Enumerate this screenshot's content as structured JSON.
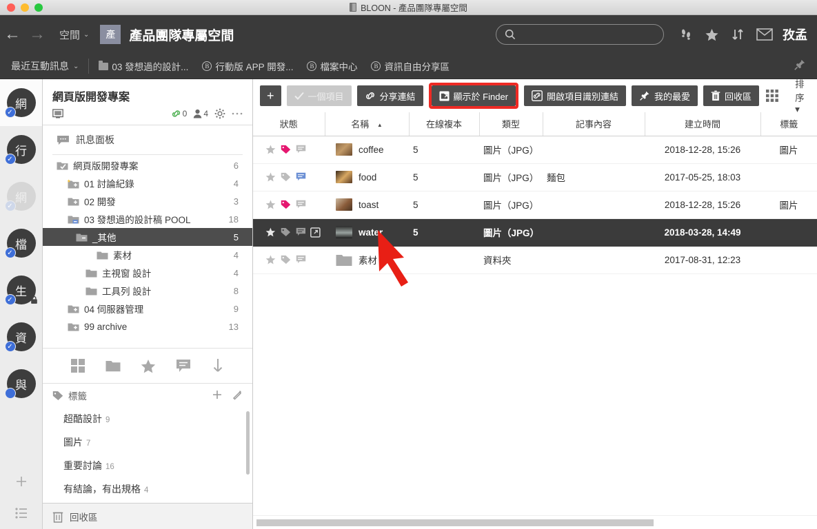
{
  "window": {
    "title": "BLOON - 產品團隊專屬空間",
    "title_icon": "book-icon"
  },
  "navbar": {
    "back_icon": "arrow-left-icon",
    "forward_icon": "arrow-right-icon",
    "space_label": "空間",
    "space_caret": "⌄",
    "space_badge": "產",
    "space_title": "產品團隊專屬空間",
    "search_placeholder": "",
    "search_value": "",
    "icons": [
      "footprints-icon",
      "star-icon",
      "sort-icon",
      "mail-icon"
    ],
    "user_name": "孜孟"
  },
  "tabbar": {
    "recent_label": "最近互動訊息",
    "recent_caret": "⌄",
    "tabs": [
      {
        "label": "03 發想過的設計...",
        "icon": "folder-icon"
      },
      {
        "label": "行動版 APP 開發...",
        "icon": "b-circle-icon"
      },
      {
        "label": "檔案中心",
        "icon": "b-circle-icon"
      },
      {
        "label": "資訊自由分享區",
        "icon": "b-circle-icon"
      }
    ],
    "pin_icon": "pin-icon"
  },
  "rail": {
    "items": [
      {
        "label": "網",
        "state": "active",
        "badge": "check",
        "locked": false
      },
      {
        "label": "行",
        "state": "normal",
        "badge": "check",
        "locked": false
      },
      {
        "label": "網",
        "state": "dim",
        "badge": "check-dim",
        "locked": false
      },
      {
        "label": "檔",
        "state": "normal",
        "badge": "check",
        "locked": false
      },
      {
        "label": "生",
        "state": "normal",
        "badge": "check",
        "locked": true
      },
      {
        "label": "資",
        "state": "normal",
        "badge": "check",
        "locked": false
      },
      {
        "label": "與",
        "state": "normal",
        "badge": "dot",
        "locked": false
      }
    ],
    "add_icon": "plus-icon",
    "list_icon": "list-icon"
  },
  "sidebar": {
    "project_title": "網頁版開發專案",
    "project_icon": "screen-icon",
    "link_count": "0",
    "member_count": "4",
    "gear_icon": "gear-icon",
    "more_icon": "more-icon",
    "message_panel": "訊息面板",
    "message_panel_icon": "chat-icon",
    "tree": [
      {
        "label": "網頁版開發專案",
        "count": "6",
        "indent": 0,
        "icon": "folder-check",
        "selected": false,
        "star": false
      },
      {
        "label": "01 討論紀錄",
        "count": "4",
        "indent": 1,
        "icon": "folder-plus",
        "selected": false,
        "star": true
      },
      {
        "label": "02 開發",
        "count": "3",
        "indent": 1,
        "icon": "folder-plus",
        "selected": false,
        "star": false
      },
      {
        "label": "03 發想過的設計稿 POOL",
        "count": "18",
        "indent": 1,
        "icon": "folder-open",
        "selected": false,
        "star": false
      },
      {
        "label": "_其他",
        "count": "5",
        "indent": 2,
        "icon": "folder-minus",
        "selected": true,
        "star": false
      },
      {
        "label": "素材",
        "count": "4",
        "indent": 3,
        "icon": "folder-plain",
        "selected": false,
        "star": false
      },
      {
        "label": "主視窗 設計",
        "count": "4",
        "indent": 2,
        "icon": "folder-plain",
        "selected": false,
        "star": false
      },
      {
        "label": "工具列 設計",
        "count": "8",
        "indent": 2,
        "icon": "folder-plain",
        "selected": false,
        "star": false
      },
      {
        "label": "04 伺服器管理",
        "count": "9",
        "indent": 1,
        "icon": "folder-plus",
        "selected": false,
        "star": false
      },
      {
        "label": "99 archive",
        "count": "13",
        "indent": 1,
        "icon": "folder-plus",
        "selected": false,
        "star": false
      }
    ],
    "tools": [
      "grid-icon",
      "folder-icon",
      "star-icon",
      "comment-icon",
      "download-icon"
    ],
    "tags_label": "標籤",
    "tags_icon": "tag-icon",
    "tag_add_icon": "plus-icon",
    "tag_edit_icon": "pencil-icon",
    "tags": [
      {
        "label": "超酷設計",
        "count": "9"
      },
      {
        "label": "圖片",
        "count": "7"
      },
      {
        "label": "重要討論",
        "count": "16"
      },
      {
        "label": "有結論，有出規格",
        "count": "4"
      }
    ],
    "trash_label": "回收區",
    "trash_icon": "trash-icon"
  },
  "toolbar": {
    "add_label": "+",
    "selected_count_label": "一個項目",
    "selected_count_icon": "check-icon",
    "share_link_label": "分享連結",
    "share_link_icon": "link-icon",
    "show_in_finder_label": "顯示於 Finder",
    "show_in_finder_icon": "finder-icon",
    "open_item_link_label": "開啟項目識別連結",
    "open_item_link_icon": "link-square-icon",
    "favorite_label": "我的最愛",
    "favorite_icon": "pin-star-icon",
    "trash_label": "回收區",
    "trash_icon": "trash-icon",
    "view_grid_icon": "grid-dots-icon",
    "sort_label": "排序",
    "sort_caret": "▾"
  },
  "table": {
    "columns": [
      {
        "label": "狀態",
        "sorted": false
      },
      {
        "label": "名稱",
        "sorted": true,
        "sort_dir": "▲"
      },
      {
        "label": "在線複本",
        "sorted": false
      },
      {
        "label": "類型",
        "sorted": false
      },
      {
        "label": "記事內容",
        "sorted": false
      },
      {
        "label": "建立時間",
        "sorted": false
      },
      {
        "label": "標籤",
        "sorted": false
      }
    ],
    "rows": [
      {
        "name": "coffee",
        "copies": "5",
        "type": "圖片（JPG）",
        "note": "",
        "created": "2018-12-28, 15:26",
        "tag": "圖片",
        "thumb": "coffee-thumb",
        "is_folder": false,
        "selected": false,
        "star_on": false,
        "tag_on": true,
        "comment_on": false,
        "link_on": false
      },
      {
        "name": "food",
        "copies": "5",
        "type": "圖片（JPG）",
        "note": "麵包",
        "created": "2017-05-25, 18:03",
        "tag": "",
        "thumb": "food-thumb",
        "is_folder": false,
        "selected": false,
        "star_on": false,
        "tag_on": false,
        "comment_on": true,
        "link_on": false
      },
      {
        "name": "toast",
        "copies": "5",
        "type": "圖片（JPG）",
        "note": "",
        "created": "2018-12-28, 15:26",
        "tag": "圖片",
        "thumb": "toast-thumb",
        "is_folder": false,
        "selected": false,
        "star_on": false,
        "tag_on": true,
        "comment_on": false,
        "link_on": false
      },
      {
        "name": "water",
        "copies": "5",
        "type": "圖片（JPG）",
        "note": "",
        "created": "2018-03-28, 14:49",
        "tag": "",
        "thumb": "water-thumb",
        "is_folder": false,
        "selected": true,
        "star_on": false,
        "tag_on": false,
        "comment_on": false,
        "link_on": true
      },
      {
        "name": "素材",
        "copies": "",
        "type": "資料夾",
        "note": "",
        "created": "2017-08-31, 12:23",
        "tag": "",
        "thumb": "folder-thumb",
        "is_folder": true,
        "selected": false,
        "star_on": false,
        "tag_on": false,
        "comment_on": false,
        "link_on": false
      }
    ]
  },
  "annotations": {
    "highlight_color": "#ee2a24",
    "arrow_name": "red-pointer-arrow"
  }
}
